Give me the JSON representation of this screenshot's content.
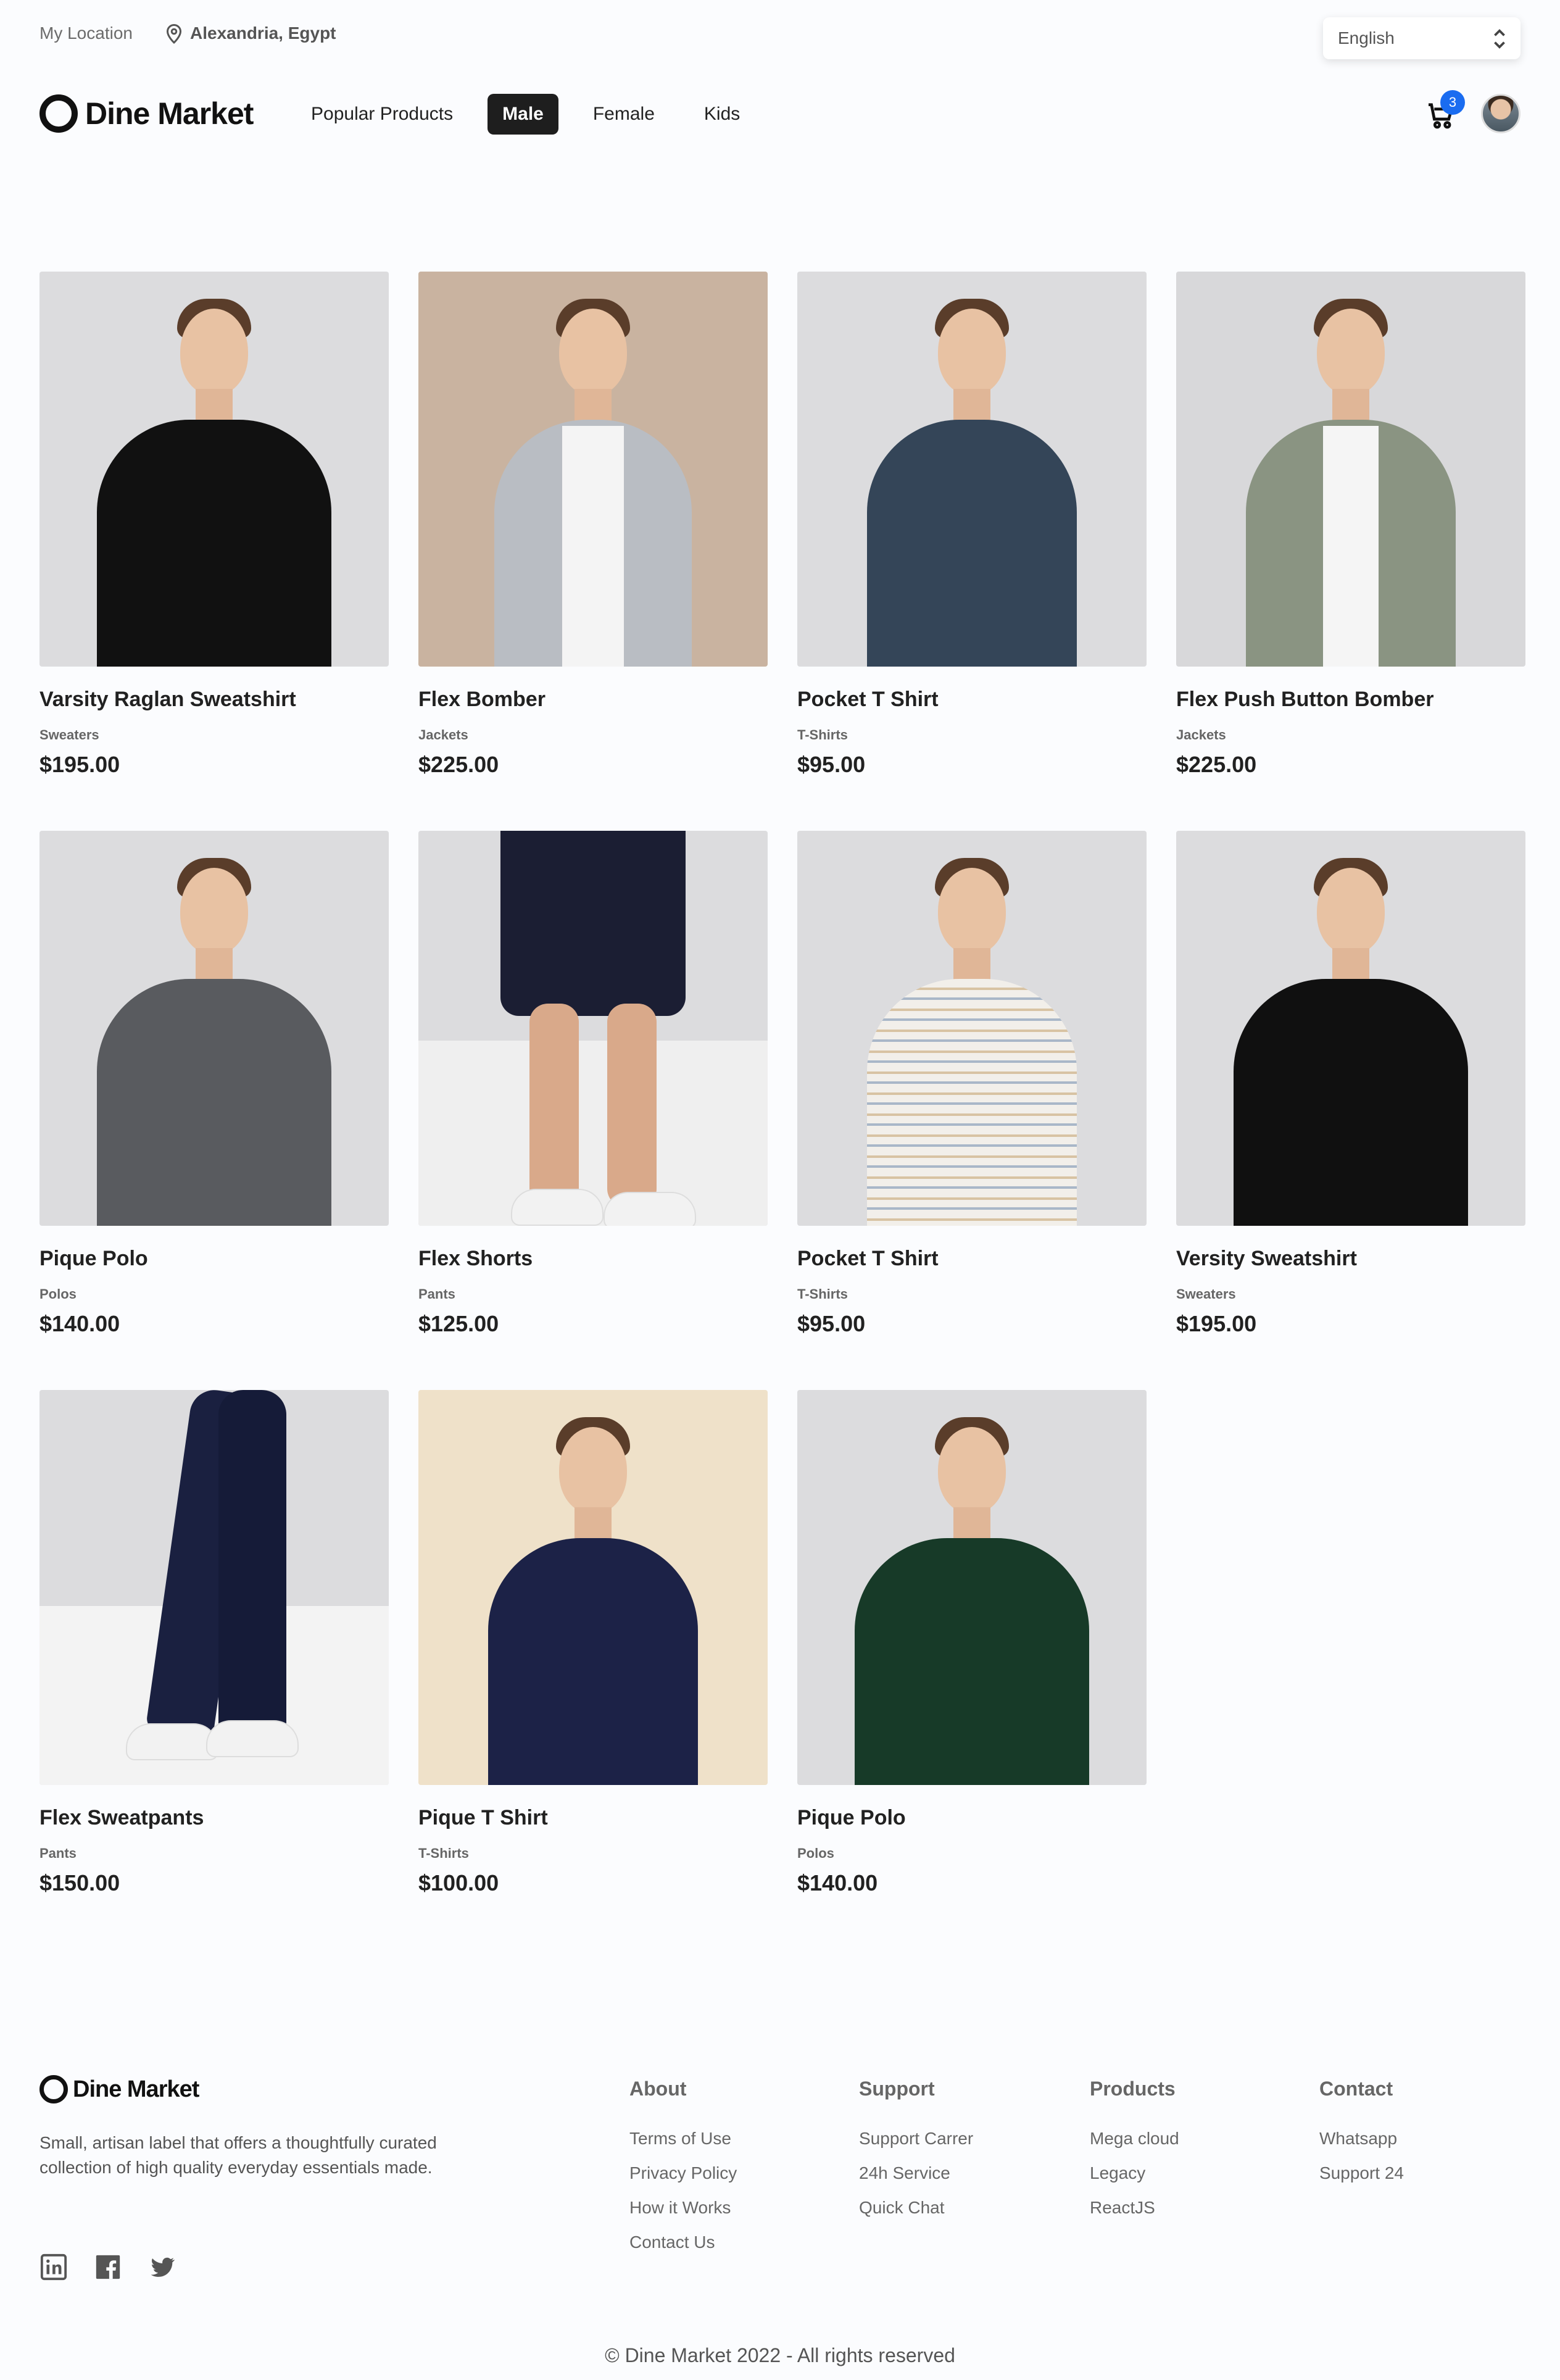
{
  "topbar": {
    "location_label": "My Location",
    "location_value": "Alexandria, Egypt",
    "language": "English"
  },
  "brand": {
    "name": "Dine Market"
  },
  "nav": {
    "links": [
      "Popular Products",
      "Male",
      "Female",
      "Kids"
    ],
    "active": "Male",
    "cart_count": "3"
  },
  "products": [
    {
      "name": "Varsity Raglan Sweatshirt",
      "category": "Sweaters",
      "price": "$195.00"
    },
    {
      "name": "Flex Bomber",
      "category": "Jackets",
      "price": "$225.00"
    },
    {
      "name": "Pocket T Shirt",
      "category": "T-Shirts",
      "price": "$95.00"
    },
    {
      "name": "Flex Push Button Bomber",
      "category": "Jackets",
      "price": "$225.00"
    },
    {
      "name": "Pique Polo",
      "category": "Polos",
      "price": "$140.00"
    },
    {
      "name": "Flex Shorts",
      "category": "Pants",
      "price": "$125.00"
    },
    {
      "name": "Pocket T Shirt",
      "category": "T-Shirts",
      "price": "$95.00"
    },
    {
      "name": "Versity Sweatshirt",
      "category": "Sweaters",
      "price": "$195.00"
    },
    {
      "name": "Flex Sweatpants",
      "category": "Pants",
      "price": "$150.00"
    },
    {
      "name": "Pique T Shirt",
      "category": "T-Shirts",
      "price": "$100.00"
    },
    {
      "name": "Pique Polo",
      "category": "Polos",
      "price": "$140.00"
    }
  ],
  "footer": {
    "description": "Small, artisan label that offers a thoughtfully curated collection of high quality everyday essentials made.",
    "columns": [
      {
        "title": "About",
        "links": [
          "Terms of Use",
          "Privacy Policy",
          "How it Works",
          "Contact Us"
        ]
      },
      {
        "title": "Support",
        "links": [
          "Support Carrer",
          "24h Service",
          "Quick Chat"
        ]
      },
      {
        "title": "Products",
        "links": [
          "Mega cloud",
          "Legacy",
          "ReactJS"
        ]
      },
      {
        "title": "Contact",
        "links": [
          "Whatsapp",
          "Support 24"
        ]
      }
    ],
    "social_icons": [
      "linkedin-icon",
      "facebook-icon",
      "twitter-icon"
    ],
    "copyright": "© Dine Market 2022 - All rights reserved"
  }
}
